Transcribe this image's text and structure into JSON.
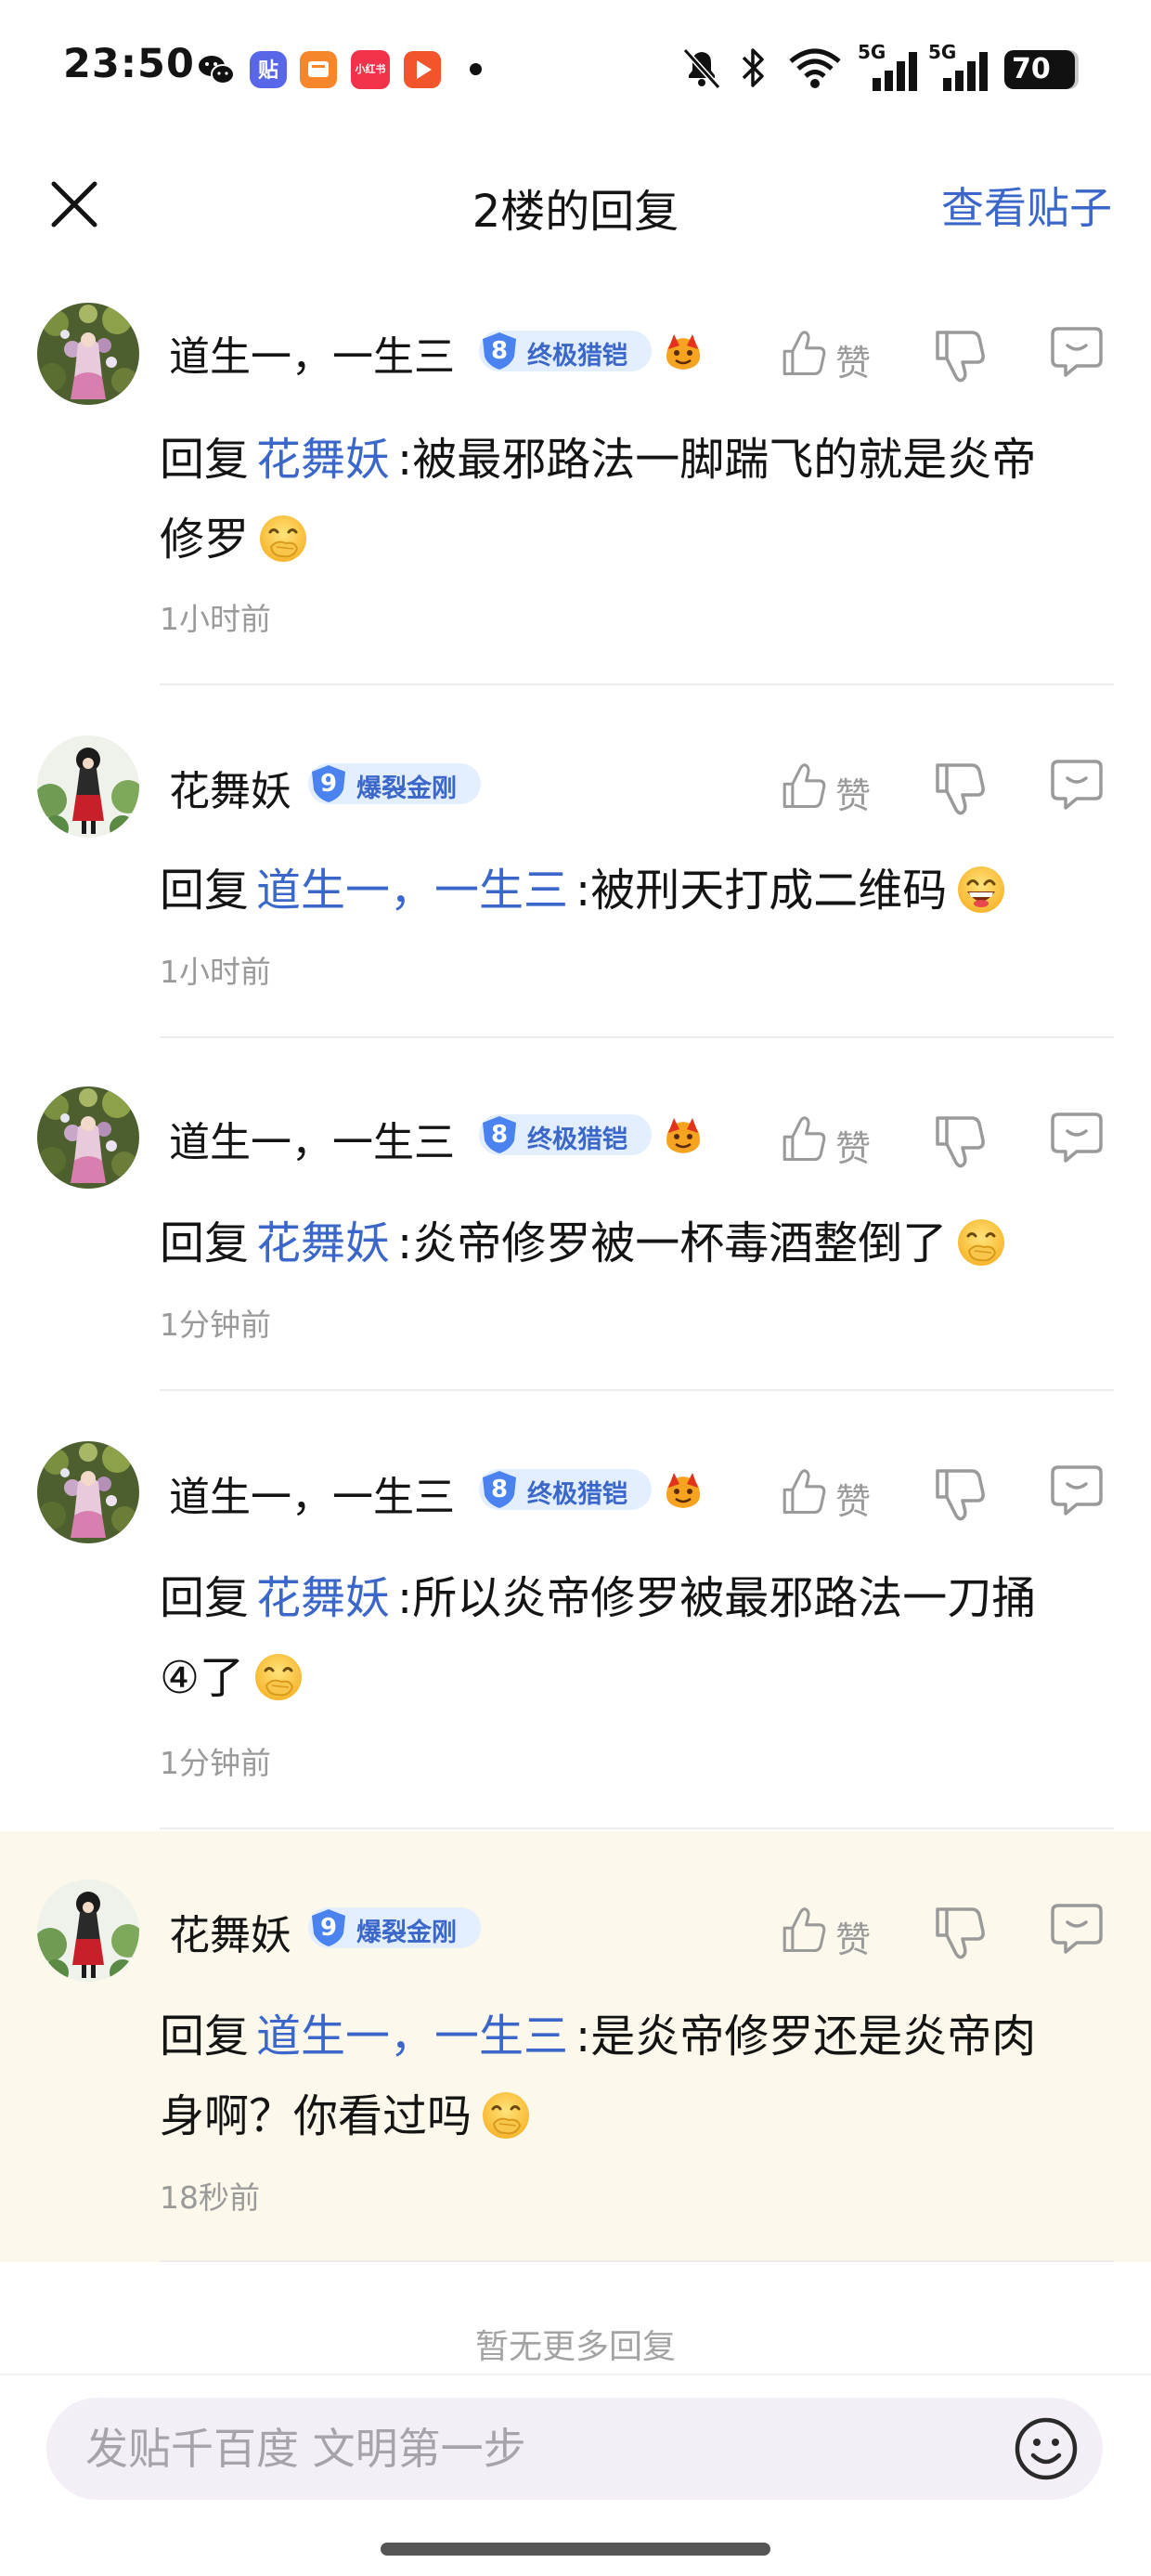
{
  "status_bar": {
    "time": "23:50",
    "battery": "70",
    "app_icons": [
      "wechat-icon",
      "tieba-icon",
      "orange-app-icon",
      "xiaohongshu-icon",
      "video-app-icon"
    ],
    "xiaohongshu_label": "小红书",
    "signal_labels": [
      "5G",
      "5G"
    ]
  },
  "header": {
    "title": "2楼的回复",
    "view_post": "查看贴子"
  },
  "reply_prefix": "回复",
  "like_label": "赞",
  "colors": {
    "link_blue": "#3a67c9",
    "badge_bg": "#e3eeff",
    "highlight_bg": "#fcf8ec",
    "muted_text": "#9a9a9a"
  },
  "replies": [
    {
      "user": "道生一，一生三",
      "avatar": "green-foliage-avatar",
      "level": "8",
      "level_title": "终极猎铠",
      "has_fan_icon": true,
      "reply_to": "花舞妖",
      "text_line1": ":被最邪路法一脚踹飞的就是炎帝",
      "text_line2": "修罗",
      "emoji": "face-with-hand-over-mouth",
      "time": "1小时前"
    },
    {
      "user": "花舞妖",
      "avatar": "anime-girl-avatar",
      "level": "9",
      "level_title": "爆裂金刚",
      "has_fan_icon": false,
      "reply_to": "道生一，一生三",
      "text_line1": ":被刑天打成二维码",
      "text_line2": "",
      "emoji": "grinning-face",
      "time": "1小时前"
    },
    {
      "user": "道生一，一生三",
      "avatar": "green-foliage-avatar",
      "level": "8",
      "level_title": "终极猎铠",
      "has_fan_icon": true,
      "reply_to": "花舞妖",
      "text_line1": ":炎帝修罗被一杯毒酒整倒了",
      "text_line2": "",
      "emoji": "face-with-hand-over-mouth",
      "time": "1分钟前"
    },
    {
      "user": "道生一，一生三",
      "avatar": "green-foliage-avatar",
      "level": "8",
      "level_title": "终极猎铠",
      "has_fan_icon": true,
      "reply_to": "花舞妖",
      "text_line1": ":所以炎帝修罗被最邪路法一刀捅",
      "text_line2": "④了",
      "emoji": "face-with-hand-over-mouth",
      "time": "1分钟前"
    },
    {
      "user": "花舞妖",
      "avatar": "anime-girl-avatar",
      "level": "9",
      "level_title": "爆裂金刚",
      "has_fan_icon": false,
      "reply_to": "道生一，一生三",
      "text_line1": ":是炎帝修罗还是炎帝肉",
      "text_line2": "身啊？你看过吗",
      "emoji": "face-with-hand-over-mouth",
      "time": "18秒前"
    }
  ],
  "footer": {
    "no_more": "暂无更多回复",
    "input_placeholder": "发贴千百度 文明第一步"
  }
}
